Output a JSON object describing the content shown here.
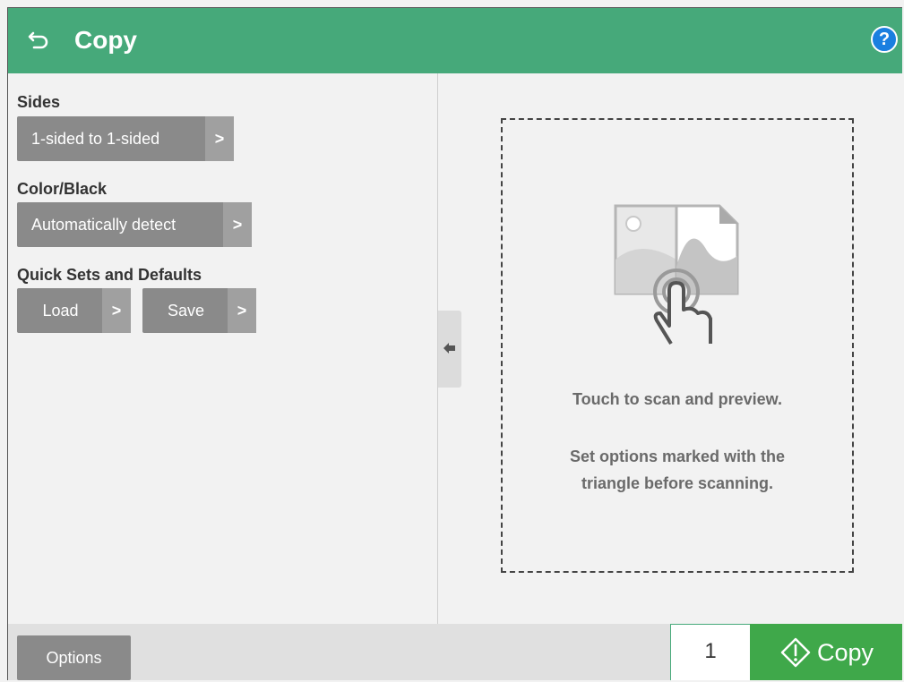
{
  "header": {
    "title": "Copy",
    "help_label": "?"
  },
  "settings": {
    "sides": {
      "label": "Sides",
      "value": "1-sided to 1-sided"
    },
    "color": {
      "label": "Color/Black",
      "value": "Automatically detect"
    },
    "quick_sets": {
      "label": "Quick Sets and Defaults",
      "load_label": "Load",
      "save_label": "Save"
    }
  },
  "preview": {
    "line1": "Touch to scan and preview.",
    "line2a": "Set options marked with the",
    "line2b": "triangle before scanning."
  },
  "footer": {
    "options_label": "Options",
    "copies_value": "1",
    "copy_label": "Copy"
  },
  "icons": {
    "back": "back-arrow-icon",
    "help": "help-icon",
    "chevron": "chevron-right-icon",
    "collapse": "arrow-left-icon",
    "preview": "scan-preview-icon",
    "start": "start-diamond-icon"
  },
  "colors": {
    "header": "#46a97a",
    "copy_button": "#3fa84a",
    "help": "#1a7fe0",
    "button": "#8a8a8a"
  }
}
